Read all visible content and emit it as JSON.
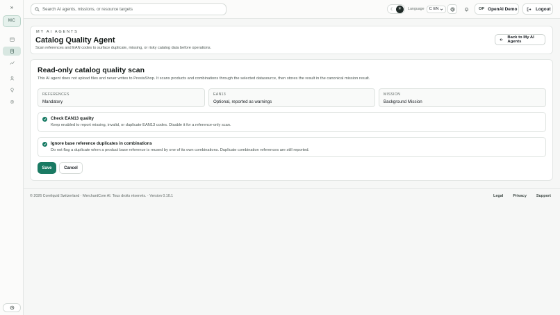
{
  "sidebar": {
    "toggle_icon": "double-chevron-right-icon",
    "org_initials": "MC",
    "nav_icons": [
      "calendar-icon",
      "clipboard-icon",
      "chart-icon",
      "user-icon",
      "pin-icon",
      "gear-icon"
    ],
    "active_index": 1,
    "bottom_icon": "settings-dial-icon"
  },
  "topbar": {
    "search_placeholder": "Search AI agents, missions, or resource targets",
    "language_label": "Language",
    "language_value": "EN",
    "language_prefix": "C",
    "user_initials": "OP",
    "user_name": "OpenAI Demo",
    "logout_label": "Logout"
  },
  "header": {
    "eyebrow": "MY AI AGENTS",
    "title": "Catalog Quality Agent",
    "subtitle": "Scan references and EAN codes to surface duplicate, missing, or risky catalog data before operations.",
    "back_label": "Back to My AI Agents"
  },
  "scan": {
    "title": "Read-only catalog quality scan",
    "intro": "This AI agent does not upload files and never writes to PrestaShop. It scans products and combinations through the selected datasource, then stores the result in the canonical mission result.",
    "fields": [
      {
        "key": "REFERENCES",
        "value": "Mandatory"
      },
      {
        "key": "EAN13",
        "value": "Optional, reported as warnings"
      },
      {
        "key": "MISSION",
        "value": "Background Mission"
      }
    ],
    "options": [
      {
        "title": "Check EAN13 quality",
        "description": "Keep enabled to report missing, invalid, or duplicate EAN13 codes. Disable it for a reference-only scan.",
        "checked": true
      },
      {
        "title": "Ignore base reference duplicates in combinations",
        "description": "Do not flag a duplicate when a product base reference is reused by one of its own combinations. Duplicate combination references are still reported.",
        "checked": true
      }
    ],
    "save_label": "Save",
    "cancel_label": "Cancel"
  },
  "footer": {
    "copyright": "© 2026 Coreliquid Switzerland · MerchantCore AI. Tous droits réservés. · Version 0.10.1",
    "links": [
      "Legal",
      "Privacy",
      "Support"
    ]
  },
  "colors": {
    "accent": "#1a7a63",
    "background": "#f6f7f6",
    "card": "#ffffff"
  }
}
